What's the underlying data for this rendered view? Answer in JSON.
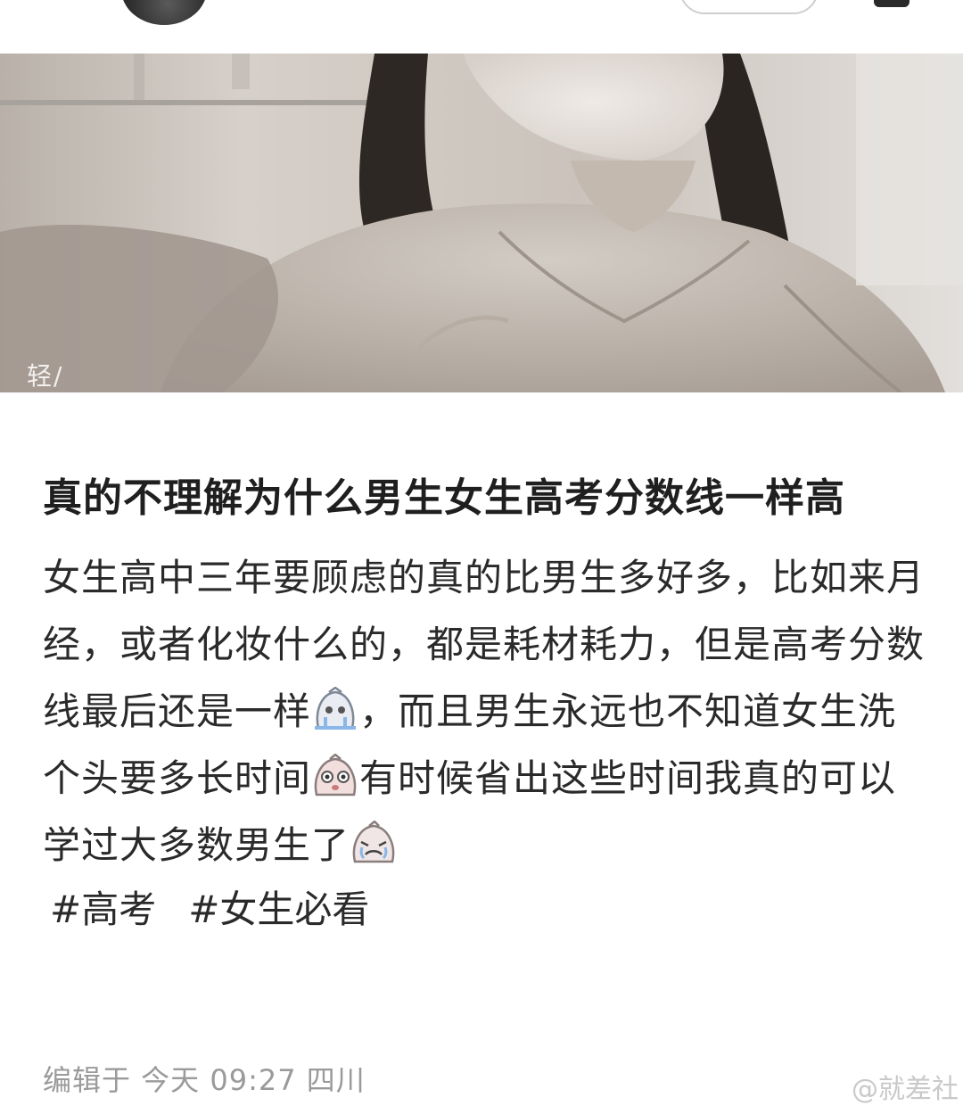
{
  "post": {
    "title": "真的不理解为什么男生女生高考分数线一样高",
    "body_part1": "女生高中三年要顾虑的真的比男生多好多，比如来月经，或者化妆什么的，都是耗材耗力，但是高考分数线最后还是一样",
    "body_part2": "，而且男生永远也不知道女生洗个头要多长时间",
    "body_part3": "有时候省出这些时间我真的可以学过大多数男生了",
    "tags": [
      "#高考",
      "#女生必看"
    ],
    "meta": "编辑于 今天 09:27 四川"
  },
  "photo": {
    "corner_mark": "轻/"
  },
  "watermark": "@就差社",
  "icons": {
    "emoji_1": "crying-emoji-icon",
    "emoji_2": "shocked-emoji-icon",
    "emoji_3": "weeping-emoji-icon"
  }
}
